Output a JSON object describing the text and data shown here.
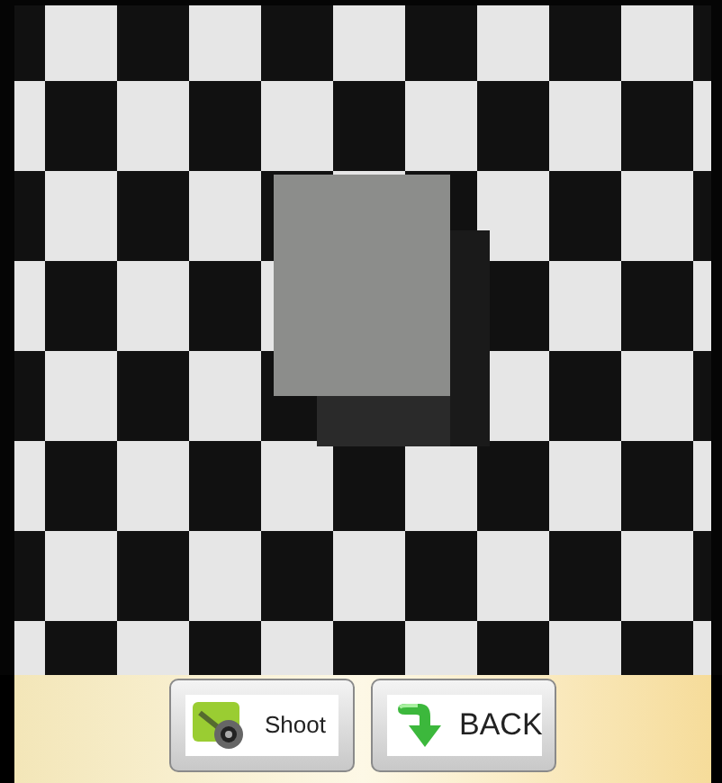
{
  "buttons": [
    {
      "kind": "shoot",
      "label": "Shoot"
    },
    {
      "kind": "back",
      "label": "BACK"
    }
  ]
}
